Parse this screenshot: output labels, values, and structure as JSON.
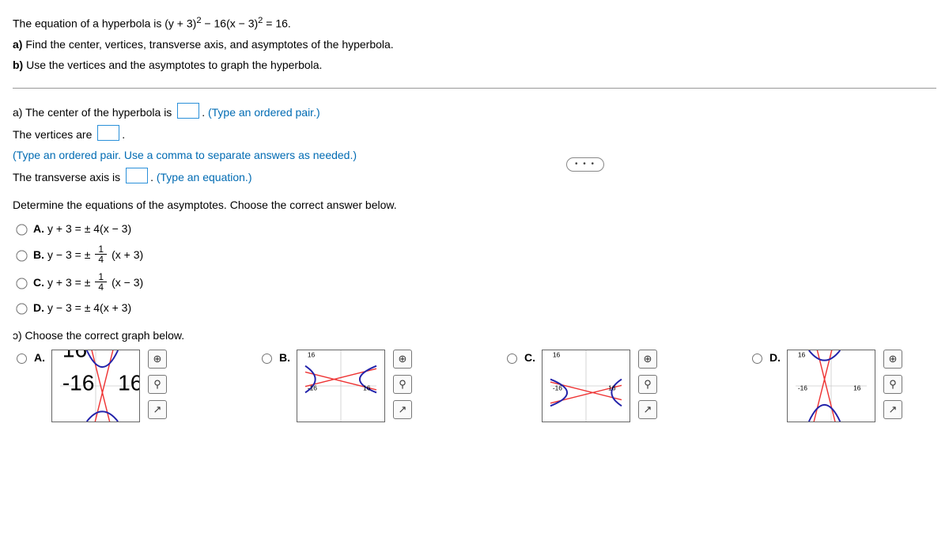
{
  "problem": {
    "equation_text": "The equation of a hyperbola is (y + 3)² − 16(x − 3)² = 16.",
    "part_a_find": "Find the center, vertices, transverse axis, and asymptotes of the hyperbola.",
    "part_b_use": "Use the vertices and the asymptotes to graph the hyperbola."
  },
  "ellipsis_label": "• • •",
  "partA": {
    "center_prefix": "a)  The center of the hyperbola is",
    "center_suffix": ". ",
    "center_hint": "(Type an ordered pair.)",
    "vertices_prefix": "The vertices are",
    "vertices_suffix": ".",
    "vertices_hint": "(Type an ordered pair. Use a comma to separate answers as needed.)",
    "transverse_prefix": "The transverse axis is",
    "transverse_suffix": ". ",
    "transverse_hint": "(Type an equation.)",
    "asymptote_prompt": "Determine the equations of the asymptotes. Choose the correct answer below.",
    "options": {
      "A": {
        "label": "A.",
        "expr": "y + 3 = ± 4(x − 3)"
      },
      "B": {
        "label": "B.",
        "expr_before": "y − 3 = ± ",
        "frac_num": "1",
        "frac_den": "4",
        "expr_after": "(x + 3)"
      },
      "C": {
        "label": "C.",
        "expr_before": "y + 3 = ± ",
        "frac_num": "1",
        "frac_den": "4",
        "expr_after": "(x − 3)"
      },
      "D": {
        "label": "D.",
        "expr": "y − 3 = ± 4(x + 3)"
      }
    }
  },
  "partB": {
    "prompt": "ɔ) Choose the correct graph below.",
    "options": [
      "A.",
      "B.",
      "C.",
      "D."
    ],
    "axis": {
      "xmin": -16,
      "xmax": 16,
      "ymin": -16,
      "ymax": 16
    },
    "tools": {
      "zoom_in": "⊕",
      "zoom_out": "⚲",
      "popout": "↗"
    }
  },
  "chart_data": [
    {
      "name": "graph-A",
      "type": "line",
      "xlim": [
        -16,
        16
      ],
      "ylim": [
        -16,
        16
      ],
      "center": [
        3,
        -3
      ],
      "asymptotes": [
        {
          "slope": 4,
          "through": [
            3,
            -3
          ]
        },
        {
          "slope": -4,
          "through": [
            3,
            -3
          ]
        }
      ],
      "branches": "vertical-opening hyperbola, vertices approx (3,1) and (3,-7)"
    },
    {
      "name": "graph-B",
      "type": "line",
      "xlim": [
        -16,
        16
      ],
      "ylim": [
        -16,
        16
      ],
      "center": [
        -3,
        3
      ],
      "asymptotes": [
        {
          "slope": 0.25,
          "through": [
            -3,
            3
          ]
        },
        {
          "slope": -0.25,
          "through": [
            -3,
            3
          ]
        }
      ],
      "branches": "horizontal-opening hyperbola, vertices approx (-7,3) and (1,3)"
    },
    {
      "name": "graph-C",
      "type": "line",
      "xlim": [
        -16,
        16
      ],
      "ylim": [
        -16,
        16
      ],
      "center": [
        3,
        -3
      ],
      "asymptotes": [
        {
          "slope": 0.25,
          "through": [
            3,
            -3
          ]
        },
        {
          "slope": -0.25,
          "through": [
            3,
            -3
          ]
        }
      ],
      "branches": "horizontal-opening hyperbola, vertices approx (-1,-3) and (7,-3)"
    },
    {
      "name": "graph-D",
      "type": "line",
      "xlim": [
        -16,
        16
      ],
      "ylim": [
        -16,
        16
      ],
      "center": [
        -3,
        3
      ],
      "asymptotes": [
        {
          "slope": 4,
          "through": [
            -3,
            3
          ]
        },
        {
          "slope": -4,
          "through": [
            -3,
            3
          ]
        }
      ],
      "branches": "vertical-opening hyperbola, vertices approx (-3,7) and (-3,-1)"
    }
  ]
}
